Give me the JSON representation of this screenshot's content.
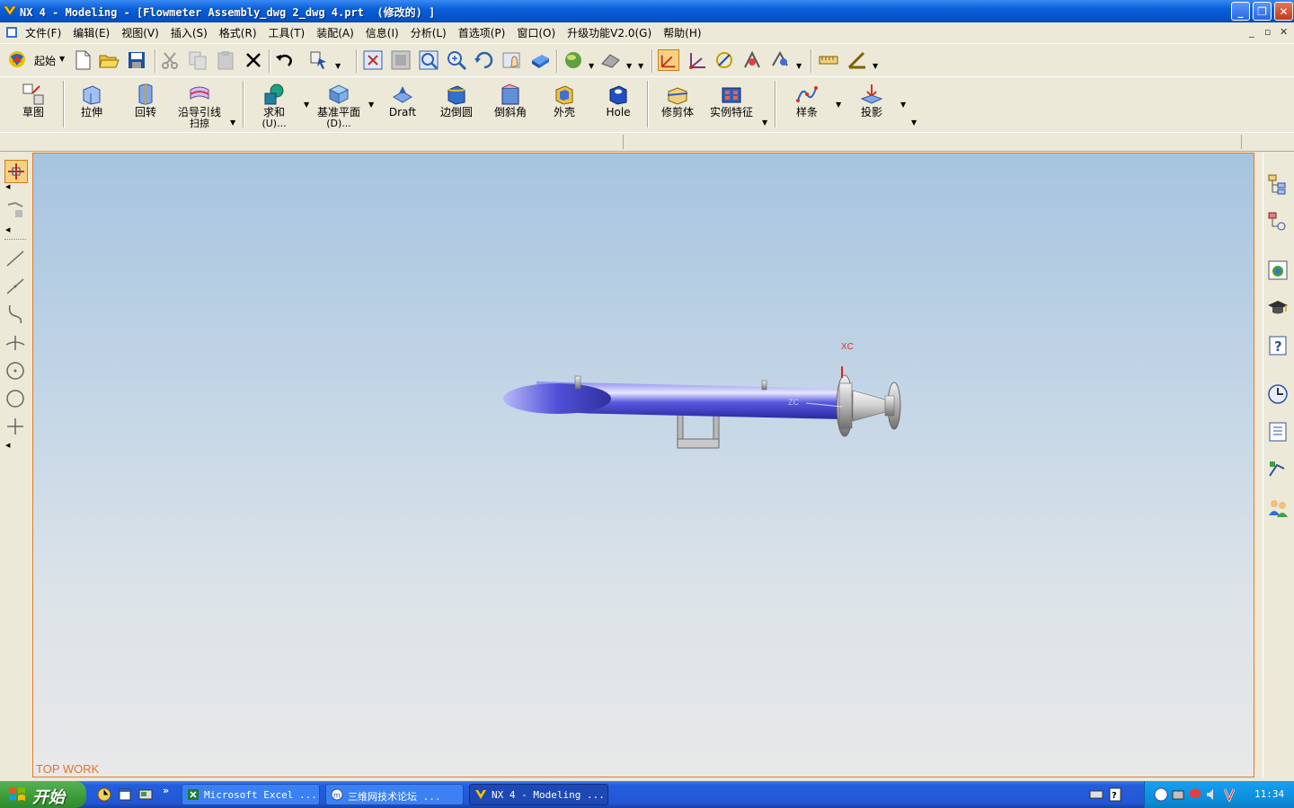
{
  "window": {
    "title": "NX 4 - Modeling - [Flowmeter Assembly_dwg 2_dwg 4.prt  (修改的) ]",
    "min_label": "_",
    "max_label": "❐",
    "close_label": "✕"
  },
  "menubar": {
    "items": [
      "文件(F)",
      "编辑(E)",
      "视图(V)",
      "插入(S)",
      "格式(R)",
      "工具(T)",
      "装配(A)",
      "信息(I)",
      "分析(L)",
      "首选项(P)",
      "窗口(O)",
      "升级功能V2.0(G)",
      "帮助(H)"
    ],
    "mdi_min": "_",
    "mdi_restore": "▫",
    "mdi_close": "✕"
  },
  "toolbar1": {
    "start_label": "起始"
  },
  "toolbar2": {
    "sketch": "草图",
    "extrude": "拉伸",
    "revolve": "回转",
    "sweep_line1": "沿导引线",
    "sweep_line2": "扫掠",
    "unite_line1": "求和",
    "unite_line2": "(U)...",
    "datum_line1": "基准平面",
    "datum_line2": "(D)...",
    "draft": "Draft",
    "edge_blend": "边倒圆",
    "chamfer": "倒斜角",
    "shell": "外壳",
    "hole": "Hole",
    "trim_body": "修剪体",
    "instance": "实例特征",
    "spline": "样条",
    "project": "投影"
  },
  "graphics": {
    "work_view": "TOP WORK",
    "xc_label": "XC",
    "colors": {
      "pipe": "#5050e0",
      "flange": "#c8c8c8",
      "bg_top": "#a6c4df",
      "bg_bottom": "#e8e8e8"
    }
  },
  "taskbar": {
    "start": "开始",
    "tasks": [
      "Microsoft Excel ...",
      "三维网技术论坛 ...",
      "NX 4 - Modeling ..."
    ],
    "clock": "11:34"
  }
}
